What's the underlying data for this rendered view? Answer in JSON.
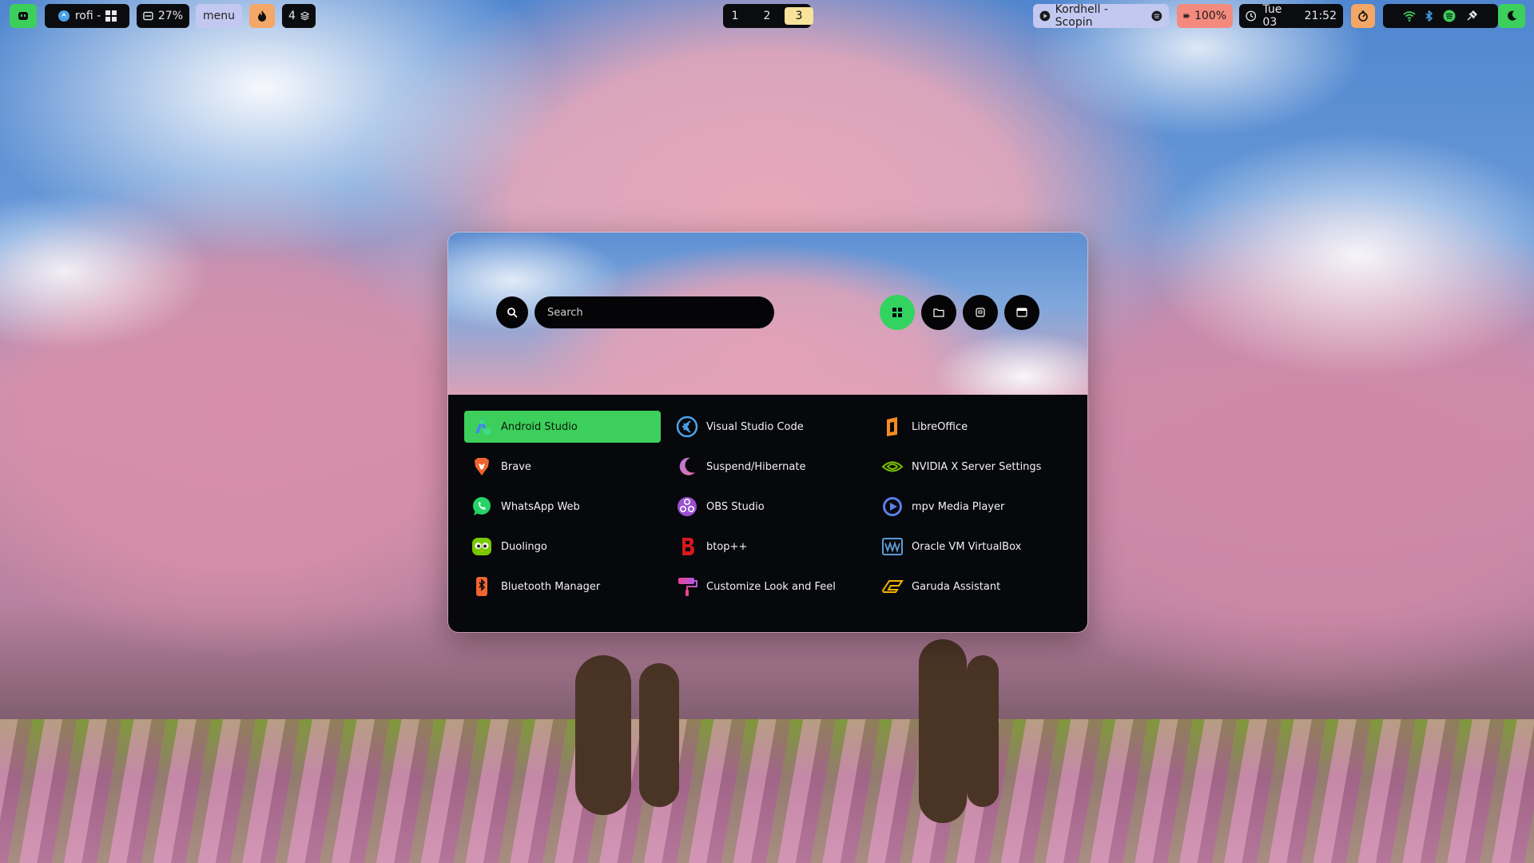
{
  "topbar": {
    "left": {
      "launcher_icon": "robot-icon",
      "window_title": "rofi -",
      "cpu_percent": "27%",
      "menu_label": "menu",
      "layers_count": "4"
    },
    "workspaces": [
      "1",
      "2",
      "3"
    ],
    "active_workspace": "3",
    "right": {
      "media_text": "Kordhell - Scopin",
      "battery_percent": "100%",
      "date": "Tue 03",
      "time": "21:52"
    }
  },
  "launcher": {
    "search": {
      "placeholder": "Search",
      "value": ""
    },
    "modes": [
      "apps-grid-icon",
      "folder-icon",
      "window-icon",
      "terminal-window-icon"
    ],
    "active_mode": "apps-grid-icon",
    "apps": [
      {
        "label": "Android Studio",
        "icon": "android-studio-icon"
      },
      {
        "label": "Visual Studio Code",
        "icon": "vscode-icon"
      },
      {
        "label": "LibreOffice",
        "icon": "libreoffice-icon"
      },
      {
        "label": "Brave",
        "icon": "brave-icon"
      },
      {
        "label": "Suspend/Hibernate",
        "icon": "moon-icon"
      },
      {
        "label": "NVIDIA X Server Settings",
        "icon": "nvidia-icon"
      },
      {
        "label": "WhatsApp Web",
        "icon": "whatsapp-icon"
      },
      {
        "label": "OBS Studio",
        "icon": "obs-icon"
      },
      {
        "label": "mpv Media Player",
        "icon": "mpv-icon"
      },
      {
        "label": "Duolingo",
        "icon": "duolingo-icon"
      },
      {
        "label": "btop++",
        "icon": "btop-icon"
      },
      {
        "label": "Oracle VM VirtualBox",
        "icon": "virtualbox-icon"
      },
      {
        "label": "Bluetooth Manager",
        "icon": "bluetooth-manager-icon"
      },
      {
        "label": "Customize Look and Feel",
        "icon": "paint-roller-icon"
      },
      {
        "label": "Garuda Assistant",
        "icon": "garuda-icon"
      }
    ],
    "selected_index": 0
  },
  "colors": {
    "accent_green": "#3ccf5b",
    "workspace_active": "#f7e39a",
    "menu_pill": "#c3c8f0",
    "battery_pill": "#f48a7e",
    "orange_pill": "#f4a766",
    "bar_dark": "#0b0c10"
  }
}
